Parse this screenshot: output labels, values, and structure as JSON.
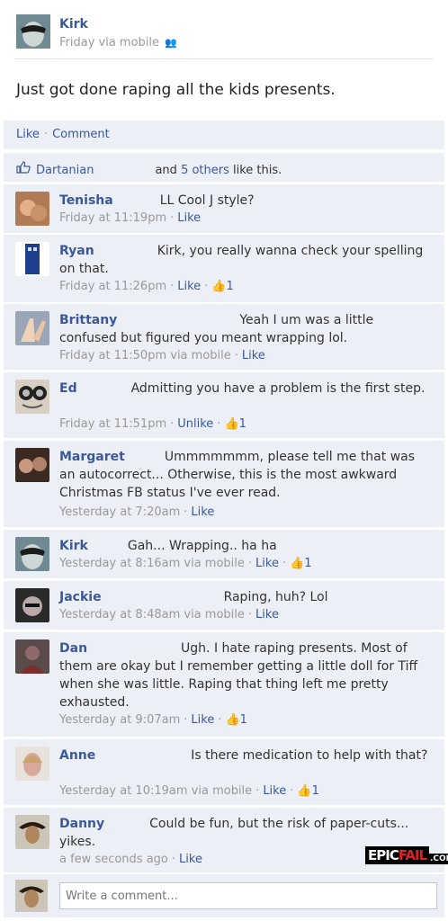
{
  "post": {
    "author": "Kirk",
    "meta": "Friday via mobile",
    "status": "Just got done raping all the kids presents."
  },
  "actions": {
    "like": "Like",
    "comment": "Comment"
  },
  "likes": {
    "first": "Dartanian",
    "and": "and",
    "others": "5 others",
    "suffix": "like this."
  },
  "comments": [
    {
      "name": "Tenisha",
      "text": "LL Cool J style?",
      "time": "Friday at 11:19pm",
      "via": "",
      "like": "Like",
      "count": ""
    },
    {
      "name": "Ryan",
      "text": "Kirk, you really wanna check your spelling on that.",
      "time": "Friday at 11:26pm",
      "via": "",
      "like": "Like",
      "count": "1"
    },
    {
      "name": "Brittany",
      "text": "Yeah I um was a little confused but figured you meant wrapping lol.",
      "time": "Friday at 11:50pm",
      "via": "via mobile",
      "like": "Like",
      "count": ""
    },
    {
      "name": "Ed",
      "text": "Admitting you have a problem is the first step.",
      "time": "Friday at 11:51pm",
      "via": "",
      "like": "Unlike",
      "count": "1"
    },
    {
      "name": "Margaret",
      "text": "Ummmmmmm, please tell me that was an autocorrect... Otherwise, this is the most awkward Christmas FB status I've ever read.",
      "time": "Yesterday at 7:20am",
      "via": "",
      "like": "Like",
      "count": ""
    },
    {
      "name": "Kirk",
      "text": "Gah... Wrapping.. ha ha",
      "time": "Yesterday at 8:16am",
      "via": "via mobile",
      "like": "Like",
      "count": "1"
    },
    {
      "name": "Jackie",
      "text": "Raping, huh? Lol",
      "time": "Yesterday at 8:48am",
      "via": "via mobile",
      "like": "Like",
      "count": ""
    },
    {
      "name": "Dan",
      "text": "Ugh. I hate raping presents. Most of them are okay but I remember getting a little doll for Tiff when she was little. Raping that thing left me pretty exhausted.",
      "time": "Yesterday at 9:07am",
      "via": "",
      "like": "Like",
      "count": "1"
    },
    {
      "name": "Anne",
      "text": "Is there medication to help with that?",
      "time": "Yesterday at 10:19am",
      "via": "via mobile",
      "like": "Like",
      "count": "1"
    },
    {
      "name": "Danny",
      "text": "Could be fun, but the risk of paper-cuts... yikes.",
      "time": "a few seconds ago",
      "via": "",
      "like": "Like",
      "count": ""
    }
  ],
  "composer": {
    "placeholder": "Write a comment..."
  },
  "watermark": {
    "epic": "EPIC",
    "fail": "FAIL",
    "com": ".COM"
  }
}
